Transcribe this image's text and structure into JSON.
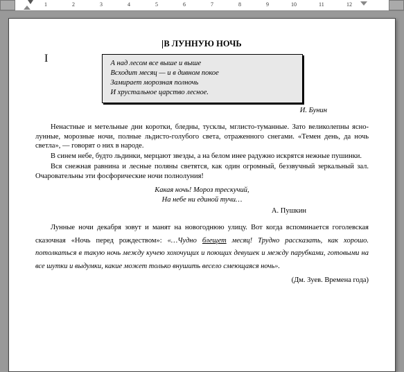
{
  "ruler": {
    "numbers": [
      1,
      2,
      3,
      4,
      5,
      6,
      7,
      8,
      9,
      10,
      11,
      12
    ]
  },
  "title": "В ЛУННУЮ НОЧЬ",
  "epigraph": {
    "line1": "А над лесом все выше и выше",
    "line2": "Всходит месяц — и в дивном покое",
    "line3": "Замирает морозная полночь",
    "line4": "И хрустальное царство лесное.",
    "author": "И. Бунин"
  },
  "p1": "Ненастные и метельные дни коротки, бледны, тусклы, мглисто-туманные. Зато великолепны ясно-лунные, морозные ночи, полные льдисто-голубого света, отраженного снегами. «Темен день, да ночь светла», — говорят о них в народе.",
  "p2": "В синем небе, будто льдинки, мерцают звезды, а на белом инее радужно искрятся нежные пушинки.",
  "p3": "Вся снежная равнина и лесные поляны светятся, как один огромный, беззвучный зеркальный зал. Очаровательны эти фосфорические ночи полнолуния!",
  "poem": {
    "line1": "Какая ночь! Мороз трескучий,",
    "line2": "На небе ни единой тучи…",
    "author": "А. Пушкин"
  },
  "p4_lead": "Лунные ночи декабря зовут и манят на новогоднюю улицу. Вот когда вспоминается гоголевская сказочная «Ночь перед рождеством»: ",
  "p4_quote1": "«…Чудно ",
  "p4_ul": "блещет",
  "p4_quote2": " месяц! Трудно рассказать, как хорошо. потолкаться в такую ночь между кучею хохочущих и поющих девушек и между парубками, готовыми на все шутки и выдумки, какие может только внушить весело смеющаяся ночь».",
  "source": "(Дм. Зуев. Времена года)"
}
